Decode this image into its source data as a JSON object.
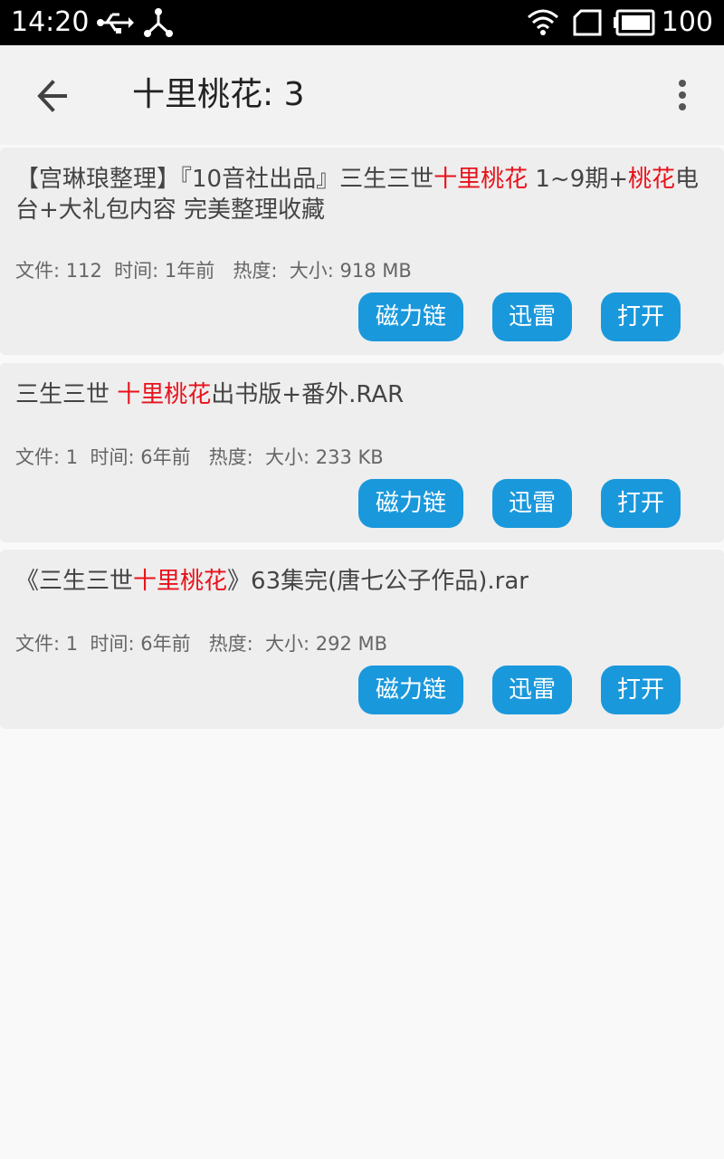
{
  "status_bar": {
    "time": "14:20",
    "battery": "100"
  },
  "app_bar": {
    "title": "十里桃花: 3"
  },
  "results": [
    {
      "title_segments": [
        {
          "text": "【宫琳琅整理】『10音社出品』三生三世",
          "hl": false
        },
        {
          "text": "十里桃花",
          "hl": true
        },
        {
          "text": " 1~9期+",
          "hl": false
        },
        {
          "text": "桃花",
          "hl": true
        },
        {
          "text": "电台+大礼包内容 完美整理收藏",
          "hl": false
        }
      ],
      "meta": "文件: 112  时间: 1年前   热度:  大小: 918 MB"
    },
    {
      "title_segments": [
        {
          "text": "三生三世 ",
          "hl": false
        },
        {
          "text": "十里桃花",
          "hl": true
        },
        {
          "text": "出书版+番外.RAR",
          "hl": false
        }
      ],
      "meta": "文件: 1  时间: 6年前   热度:  大小: 233 KB"
    },
    {
      "title_segments": [
        {
          "text": "《三生三世",
          "hl": false
        },
        {
          "text": "十里桃花",
          "hl": true
        },
        {
          "text": "》63集完(唐七公子作品).rar",
          "hl": false
        }
      ],
      "meta": "文件: 1  时间: 6年前   热度:  大小: 292 MB"
    }
  ],
  "actions": {
    "magnet": "磁力链",
    "thunder": "迅雷",
    "open": "打开"
  },
  "colors": {
    "accent": "#1a98dc",
    "highlight": "#e8121b"
  }
}
